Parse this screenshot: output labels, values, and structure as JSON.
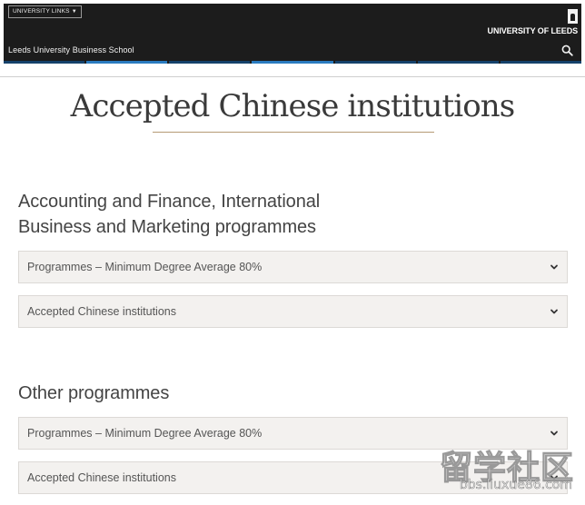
{
  "header": {
    "university_links": "UNIVERSITY LINKS",
    "school_name": "Leeds University Business School",
    "logo_text": "UNIVERSITY OF LEEDS",
    "search_icon": "search-icon",
    "nav_colors": {
      "dark": "#15426b",
      "highlight": "#2a7bbf"
    }
  },
  "main": {
    "title": "Accepted Chinese institutions",
    "sections": [
      {
        "heading_line1": "Accounting and Finance, International",
        "heading_line2": "Business and Marketing programmes",
        "accordions": [
          {
            "label": "Programmes – Minimum Degree Average 80%"
          },
          {
            "label": "Accepted Chinese institutions"
          }
        ]
      },
      {
        "heading": "Other programmes",
        "accordions": [
          {
            "label": "Programmes – Minimum Degree Average 80%"
          },
          {
            "label": "Accepted Chinese institutions"
          }
        ]
      }
    ]
  },
  "watermark": {
    "big": "留学社区",
    "small": "bbs.liuxue86.com"
  }
}
